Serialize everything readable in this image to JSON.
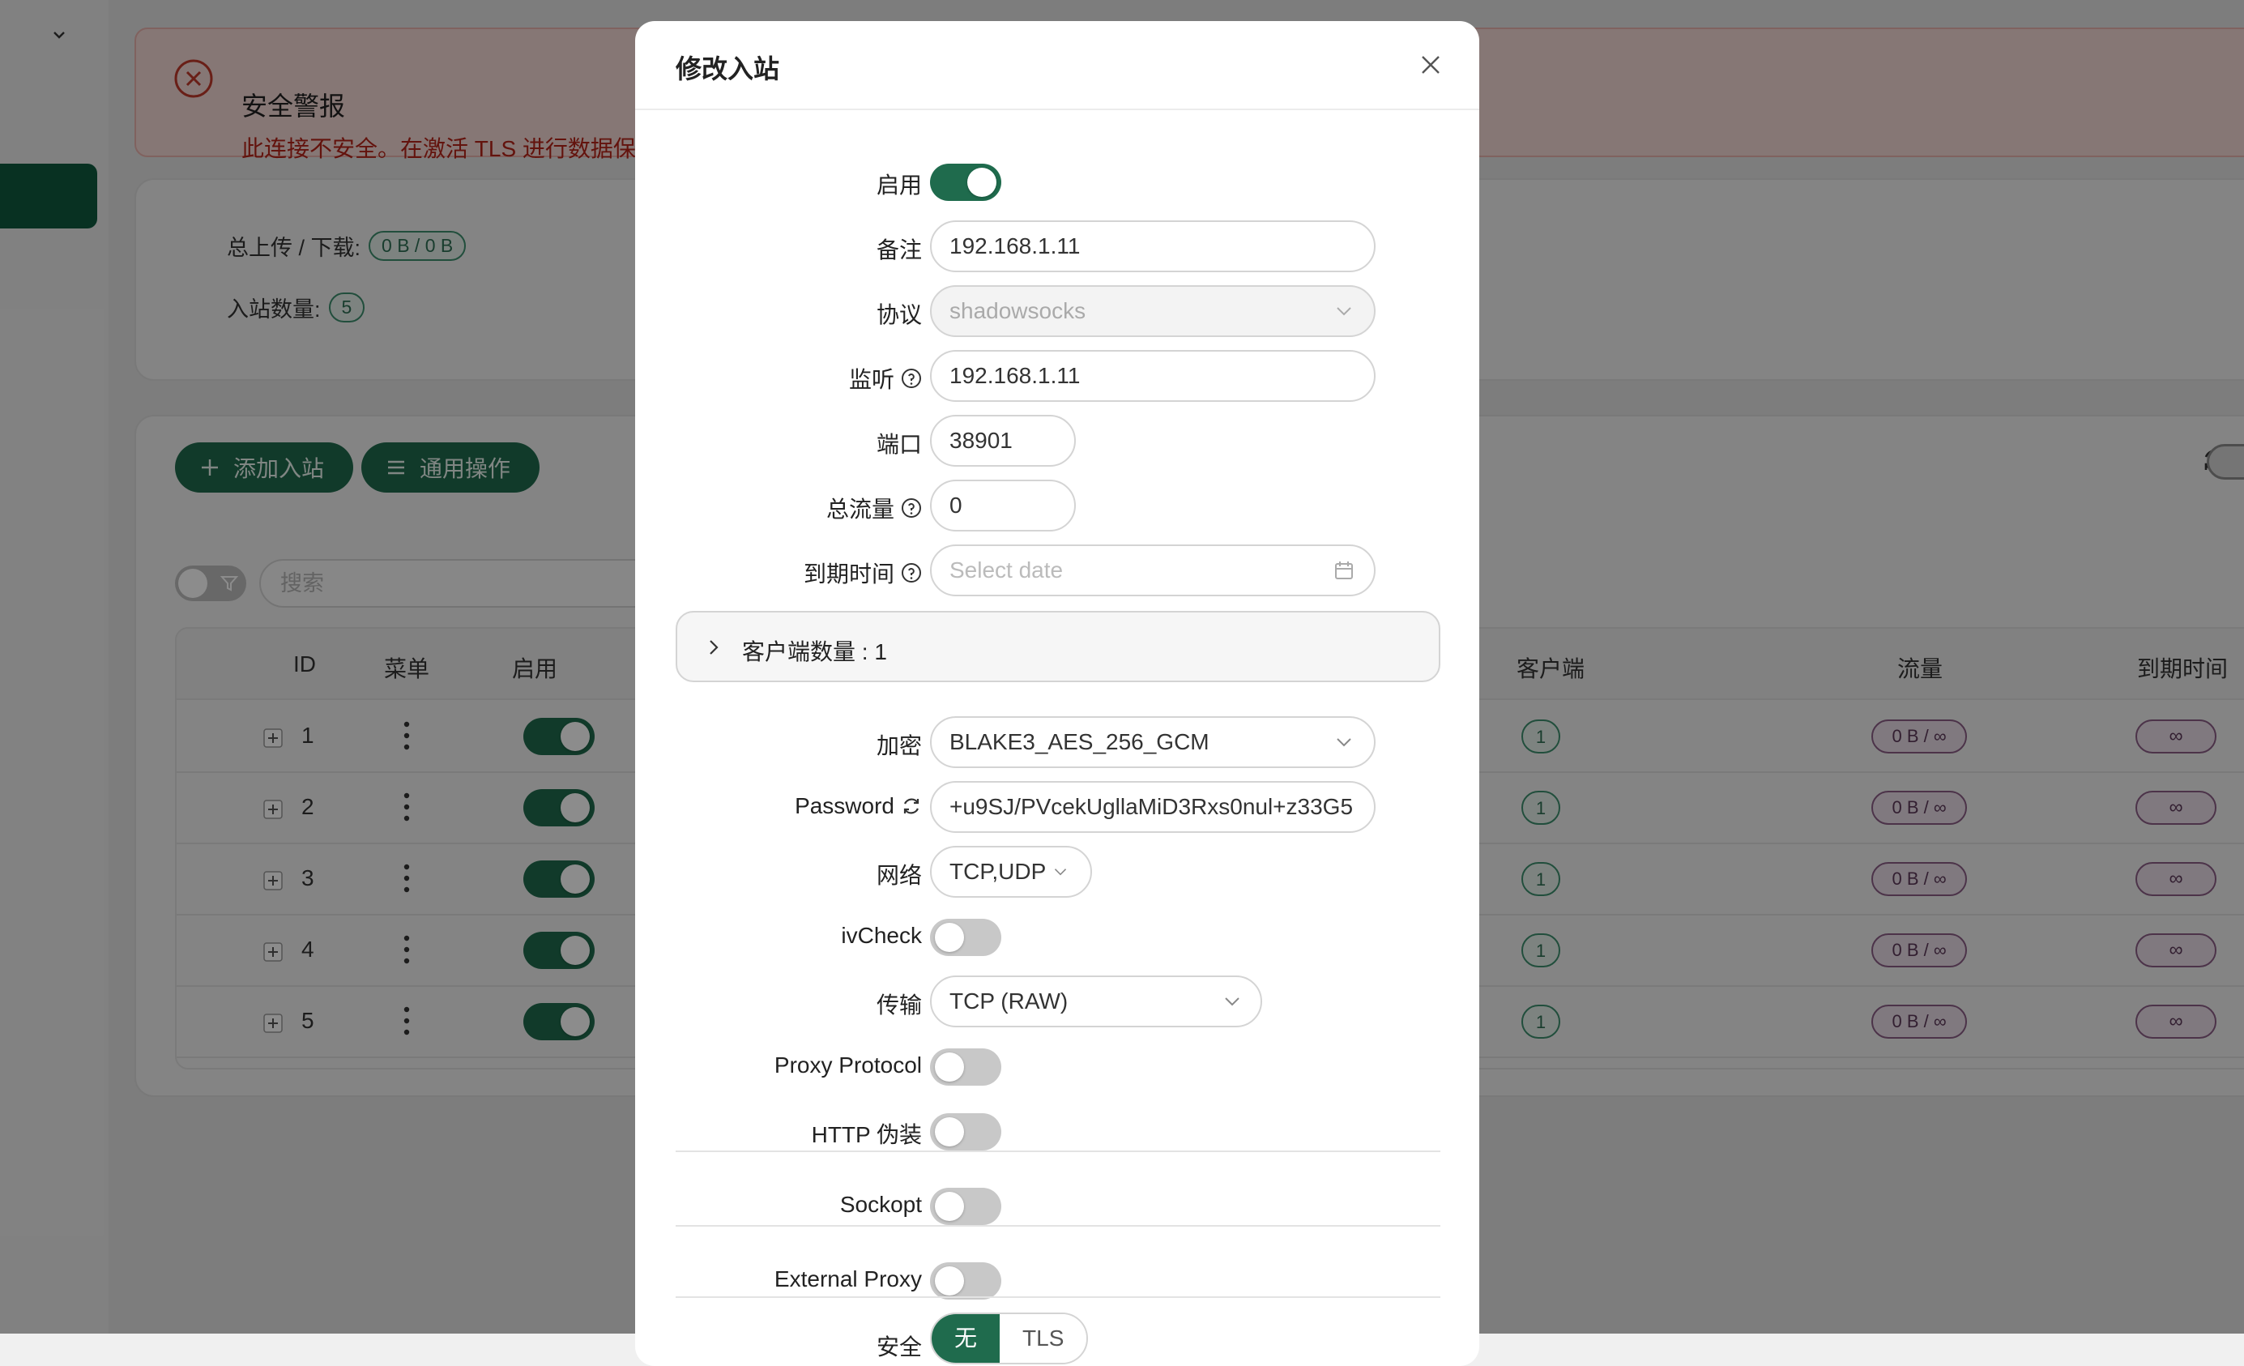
{
  "colors": {
    "primary": "#1f6b4d",
    "alert_text": "#b42318",
    "alert_bg": "#f4d9d6"
  },
  "alert": {
    "title": "安全警报",
    "description": "此连接不安全。在激活 TLS 进行数据保护之前，请勿输入敏感信息。"
  },
  "stats": {
    "total_label": "总上传 / 下载:",
    "total_value": "0 B / 0 B",
    "inbound_count_label": "入站数量:",
    "inbound_count": "5"
  },
  "toolbar": {
    "add_inbound": "添加入站",
    "general_actions": "通用操作"
  },
  "search": {
    "placeholder": "搜索"
  },
  "table": {
    "headers": {
      "id": "ID",
      "menu": "菜单",
      "enable": "启用",
      "clients": "客户端",
      "traffic": "流量",
      "expiry": "到期时间"
    },
    "rows": [
      {
        "id": "1",
        "enabled": true,
        "clients": "1",
        "traffic": "0 B / ∞",
        "expiry": "∞"
      },
      {
        "id": "2",
        "enabled": true,
        "clients": "1",
        "traffic": "0 B / ∞",
        "expiry": "∞"
      },
      {
        "id": "3",
        "enabled": true,
        "clients": "1",
        "traffic": "0 B / ∞",
        "expiry": "∞"
      },
      {
        "id": "4",
        "enabled": true,
        "clients": "1",
        "traffic": "0 B / ∞",
        "expiry": "∞"
      },
      {
        "id": "5",
        "enabled": true,
        "clients": "1",
        "traffic": "0 B / ∞",
        "expiry": "∞"
      }
    ]
  },
  "modal": {
    "title": "修改入站",
    "enable_label": "启用",
    "enable_on": true,
    "remark_label": "备注",
    "remark_value": "192.168.1.11",
    "protocol_label": "协议",
    "protocol_value": "shadowsocks",
    "listen_label": "监听",
    "listen_value": "192.168.1.11",
    "port_label": "端口",
    "port_value": "38901",
    "total_traffic_label": "总流量",
    "total_traffic_value": "0",
    "expiry_label": "到期时间",
    "expiry_placeholder": "Select date",
    "clients_count_label": "客户端数量 : 1",
    "encryption_label": "加密",
    "encryption_value": "BLAKE3_AES_256_GCM",
    "password_label": "Password",
    "password_value": "+u9SJ/PVcekUgllaMiD3Rxs0nul+z33G5",
    "network_label": "网络",
    "network_value": "TCP,UDP",
    "ivcheck_label": "ivCheck",
    "transport_label": "传输",
    "transport_value": "TCP (RAW)",
    "proxy_protocol_label": "Proxy Protocol",
    "http_camouflage_label": "HTTP 伪装",
    "sockopt_label": "Sockopt",
    "external_proxy_label": "External Proxy",
    "security_label": "安全",
    "security_options": [
      "无",
      "TLS"
    ]
  }
}
